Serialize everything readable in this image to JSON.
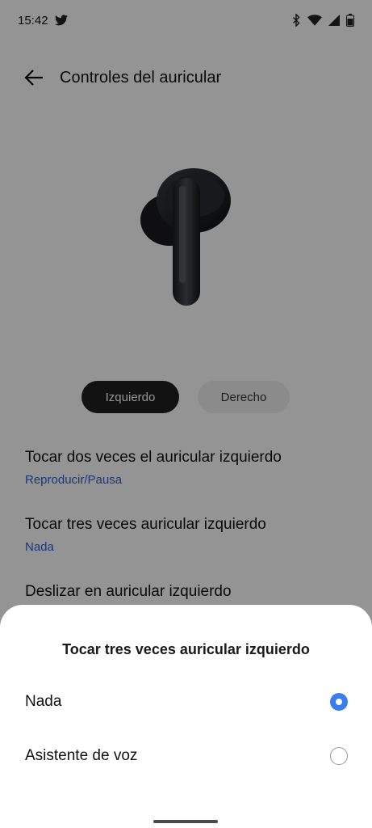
{
  "status_bar": {
    "time": "15:42"
  },
  "toolbar": {
    "title": "Controles del auricular"
  },
  "segment": {
    "left_label": "Izquierdo",
    "right_label": "Derecho",
    "selected": "Izquierdo"
  },
  "settings": [
    {
      "title": "Tocar dos veces el auricular izquierdo",
      "value": "Reproducir/Pausa"
    },
    {
      "title": "Tocar tres veces auricular izquierdo",
      "value": "Nada"
    },
    {
      "title": "Deslizar en auricular izquierdo",
      "value": ""
    }
  ],
  "sheet": {
    "title": "Tocar tres veces auricular izquierdo",
    "options": [
      {
        "label": "Nada",
        "selected": true
      },
      {
        "label": "Asistente de voz",
        "selected": false
      }
    ]
  },
  "colors": {
    "accent": "#3b7cf0",
    "link": "#2f5fd0"
  }
}
